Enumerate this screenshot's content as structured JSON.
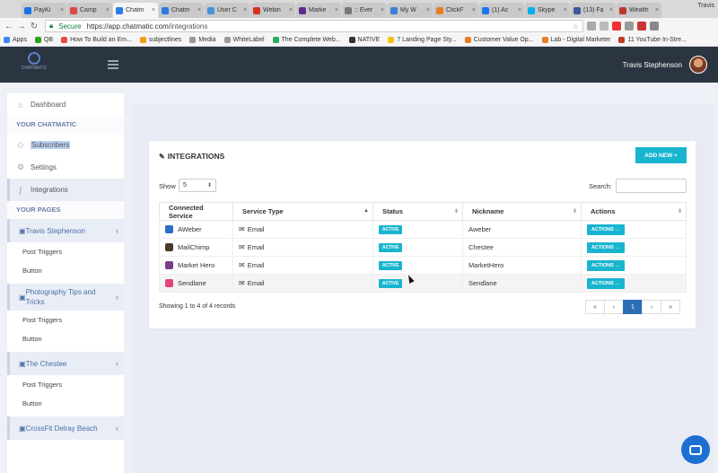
{
  "browser": {
    "tabs": [
      {
        "label": "PayKi",
        "color": "#1a73e8",
        "active": false
      },
      {
        "label": "Camp",
        "color": "#e04444",
        "active": false
      },
      {
        "label": "Chatm",
        "color": "#2c7be5",
        "active": true
      },
      {
        "label": "Chatm",
        "color": "#2c7be5",
        "active": false
      },
      {
        "label": "User C",
        "color": "#4a90d9",
        "active": false
      },
      {
        "label": "Webin",
        "color": "#d93025",
        "active": false
      },
      {
        "label": "Marke",
        "color": "#5b2c8c",
        "active": false
      },
      {
        "label": ":: Ever",
        "color": "#777777",
        "active": false
      },
      {
        "label": "My W",
        "color": "#3b7dd8",
        "active": false
      },
      {
        "label": "ClickF",
        "color": "#e67e22",
        "active": false
      },
      {
        "label": "(1) Ac",
        "color": "#1877f2",
        "active": false
      },
      {
        "label": "Skype",
        "color": "#00aff0",
        "active": false
      },
      {
        "label": "(13) Fa",
        "color": "#3b5998",
        "active": false
      },
      {
        "label": "Wealth",
        "color": "#c0392b",
        "active": false
      }
    ],
    "profile": "Travis",
    "secure_label": "Secure",
    "url_host": "https://app.chatmatic.com",
    "url_path": "/integrations",
    "bookmarks": [
      {
        "label": "Apps",
        "color": "#4285f4"
      },
      {
        "label": "QB",
        "color": "#2ca01c"
      },
      {
        "label": "How To Build an Em...",
        "color": "#e74c3c"
      },
      {
        "label": "subjectlines",
        "color": "#f39c12"
      },
      {
        "label": "Media",
        "color": "#999999"
      },
      {
        "label": "WhiteLabel",
        "color": "#999999"
      },
      {
        "label": "The Complete Web...",
        "color": "#27ae60"
      },
      {
        "label": "NATIVE",
        "color": "#333333"
      },
      {
        "label": "7 Landing Page Sty...",
        "color": "#f1c40f"
      },
      {
        "label": "Customer Value Op...",
        "color": "#e67e22"
      },
      {
        "label": "Lab - Digital Marketer",
        "color": "#e67e22"
      },
      {
        "label": "11 YouTube In-Stre...",
        "color": "#c0392b"
      }
    ]
  },
  "header": {
    "logo_text": "CHATMATIC",
    "user_name": "Travis Stephenson"
  },
  "sidebar": {
    "dashboard": "Dashboard",
    "section_chatmatic": "YOUR CHATMATIC",
    "subscribers": "Subscribers",
    "settings": "Settings",
    "integrations": "Integrations",
    "section_pages": "YOUR PAGES",
    "pages": [
      {
        "name": "Travis Stephenson",
        "subs": [
          "Post Triggers",
          "Button"
        ]
      },
      {
        "name": "Photography Tips and Tricks",
        "subs": [
          "Post Triggers",
          "Button"
        ]
      },
      {
        "name": "The Chestee",
        "subs": [
          "Post Triggers",
          "Button"
        ]
      },
      {
        "name": "CrossFit Delray Beach",
        "subs": []
      }
    ]
  },
  "integrations": {
    "title": "INTEGRATIONS",
    "add_button": "ADD NEW +",
    "show_label": "Show",
    "show_value": "5",
    "search_label": "Search:",
    "search_value": "",
    "columns": [
      "Connected Service",
      "Service Type",
      "Status",
      "Nickname",
      "Actions"
    ],
    "rows": [
      {
        "service": "AWeber",
        "icon_color": "#2b6fc4",
        "type": "Email",
        "status": "ACTIVE",
        "nickname": "Aweber",
        "action": "ACTIONS →"
      },
      {
        "service": "MailChimp",
        "icon_color": "#4a3b2a",
        "type": "Email",
        "status": "ACTIVE",
        "nickname": "Chestee",
        "action": "ACTIONS →"
      },
      {
        "service": "Market Hero",
        "icon_color": "#7a3b8c",
        "type": "Email",
        "status": "ACTIVE",
        "nickname": "MarketHero",
        "action": "ACTIONS →"
      },
      {
        "service": "Sendlane",
        "icon_color": "#e0457b",
        "type": "Email",
        "status": "ACTIVE",
        "nickname": "Sendlane",
        "action": "ACTIONS →"
      }
    ],
    "records_text": "Showing 1 to 4 of 4 records",
    "pager": [
      "«",
      "‹",
      "1",
      "›",
      "»"
    ],
    "current_page": "1"
  },
  "colors": {
    "accent": "#19b5cf",
    "header_bg": "#2b3441",
    "page_link": "#4a6fa5",
    "pager_active": "#2a6fb6"
  }
}
